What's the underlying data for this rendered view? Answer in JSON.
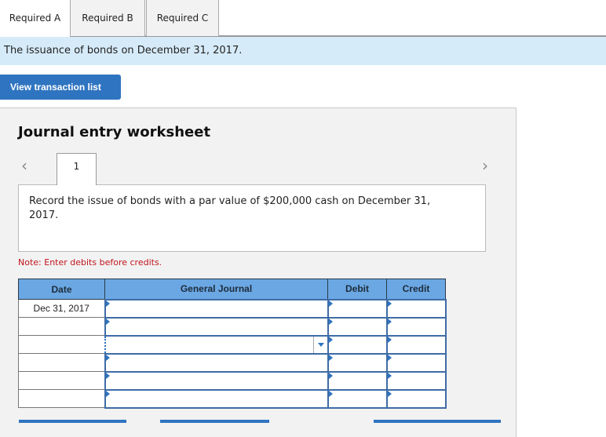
{
  "tabs": [
    {
      "label": "Required A",
      "active": true
    },
    {
      "label": "Required B",
      "active": false
    },
    {
      "label": "Required C",
      "active": false
    }
  ],
  "info_bar": {
    "text": "The issuance of bonds on December 31, 2017."
  },
  "view_button": {
    "label": "View transaction list"
  },
  "worksheet": {
    "title": "Journal entry worksheet",
    "prev_icon": "chevron-left-icon",
    "next_icon": "chevron-right-icon",
    "entry_tab": "1",
    "description": "Record the issue of bonds with a par value of $200,000 cash on December 31, 2017.",
    "note": "Note: Enter debits before credits.",
    "table": {
      "headers": [
        "Date",
        "General Journal",
        "Debit",
        "Credit"
      ],
      "rows": [
        {
          "date": "Dec 31, 2017",
          "account": "",
          "debit": "",
          "credit": ""
        },
        {
          "date": "",
          "account": "",
          "debit": "",
          "credit": ""
        },
        {
          "date": "",
          "account": "",
          "debit": "",
          "credit": "",
          "focused": true
        },
        {
          "date": "",
          "account": "",
          "debit": "",
          "credit": ""
        },
        {
          "date": "",
          "account": "",
          "debit": "",
          "credit": ""
        },
        {
          "date": "",
          "account": "",
          "debit": "",
          "credit": ""
        }
      ]
    }
  },
  "colors": {
    "accent": "#2f74c0",
    "header_bg": "#6ba7e3",
    "info_bg": "#d6ebf9",
    "note": "#c0141c"
  }
}
